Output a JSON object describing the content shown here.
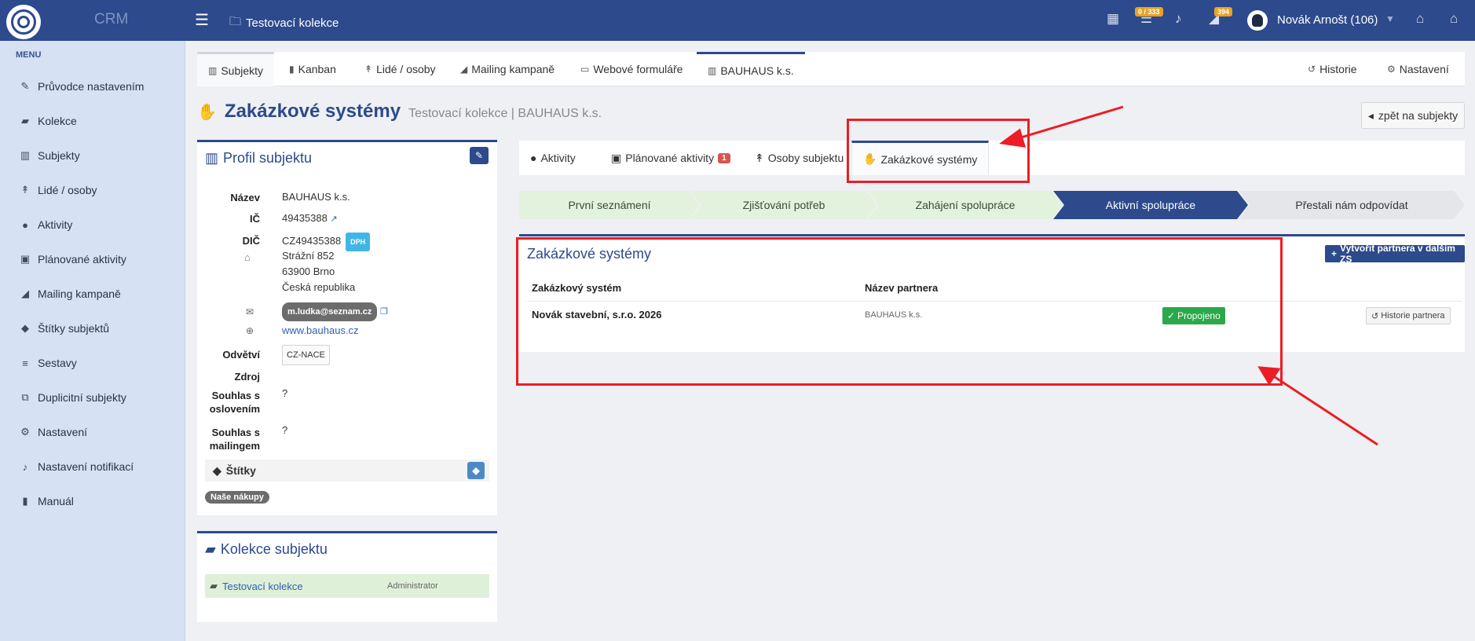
{
  "topbar": {
    "brand": "CRM",
    "breadcrumb": "Testovací kolekce",
    "tasks_badge": "0 / 333",
    "notif_badge": "394",
    "user": "Novák Arnošt (106)"
  },
  "sidebar": {
    "heading": "MENU",
    "items": [
      {
        "label": "Průvodce nastavením",
        "icon": "pencil-icon"
      },
      {
        "label": "Kolekce",
        "icon": "folder-icon"
      },
      {
        "label": "Subjekty",
        "icon": "building-icon"
      },
      {
        "label": "Lidé / osoby",
        "icon": "person-icon"
      },
      {
        "label": "Aktivity",
        "icon": "comments-icon"
      },
      {
        "label": "Plánované aktivity",
        "icon": "calendar-icon"
      },
      {
        "label": "Mailing kampaně",
        "icon": "megaphone-icon"
      },
      {
        "label": "Štítky subjektů",
        "icon": "tag-icon"
      },
      {
        "label": "Sestavy",
        "icon": "list-icon"
      },
      {
        "label": "Duplicitní subjekty",
        "icon": "duplicate-icon"
      },
      {
        "label": "Nastavení",
        "icon": "gears-icon"
      },
      {
        "label": "Nastavení notifikací",
        "icon": "bell-icon"
      },
      {
        "label": "Manuál",
        "icon": "book-icon"
      }
    ]
  },
  "maintabs": {
    "subjekty": "Subjekty",
    "kanban": "Kanban",
    "lide": "Lidé / osoby",
    "mailing": "Mailing kampaně",
    "formulare": "Webové formuláře",
    "bauhaus": "BAUHAUS k.s.",
    "historie": "Historie",
    "nastaveni": "Nastavení"
  },
  "page": {
    "title": "Zakázkové systémy",
    "subtitle": "Testovací kolekce | BAUHAUS k.s.",
    "back_button": "zpět na subjekty"
  },
  "profile": {
    "title": "Profil subjektu",
    "labels": {
      "nazev": "Název",
      "ic": "IČ",
      "dic": "DIČ",
      "odvetvi": "Odvětví",
      "zdroj": "Zdroj",
      "souhlas_oslov_1": "Souhlas s",
      "souhlas_oslov_2": "oslovením",
      "souhlas_mail_1": "Souhlas s",
      "souhlas_mail_2": "mailingem"
    },
    "nazev": "BAUHAUS k.s.",
    "ic": "49435388",
    "dic": "CZ49435388",
    "dph": "DPH",
    "address_street": "Strážní 852",
    "address_city": "63900 Brno",
    "address_country": "Česká republika",
    "email": "m.ludka@seznam.cz",
    "web": "www.bauhaus.cz",
    "nace": "CZ-NACE",
    "souhlas_osloveni": "?",
    "souhlas_mailing": "?",
    "tags_title": "Štítky",
    "tag": "Naše nákupy"
  },
  "kolekce": {
    "title": "Kolekce subjektu",
    "name": "Testovací kolekce",
    "role": "Administrator"
  },
  "subtabs": {
    "aktivity": "Aktivity",
    "planovane": "Plánované aktivity",
    "planovane_count": "1",
    "osoby": "Osoby subjektu",
    "zakazkove": "Zakázkové systémy"
  },
  "pipeline": [
    "První seznámení",
    "Zjišťování potřeb",
    "Zahájení spolupráce",
    "Aktivní spolupráce",
    "Přestali nám odpovídat"
  ],
  "zs": {
    "title": "Zakázkové systémy",
    "create_button": "Vytvořit partnera v dalším ZS",
    "col_system": "Zakázkový systém",
    "col_partner": "Název partnera",
    "row_system": "Novák stavební, s.r.o. 2026",
    "row_partner": "BAUHAUS k.s.",
    "row_status": "Propojeno",
    "row_history": "Historie partnera"
  },
  "colors": {
    "primary": "#2c4a8c",
    "sidebar": "#d6e1f4",
    "success": "#2aa84a",
    "annotation": "#ee1c24"
  }
}
